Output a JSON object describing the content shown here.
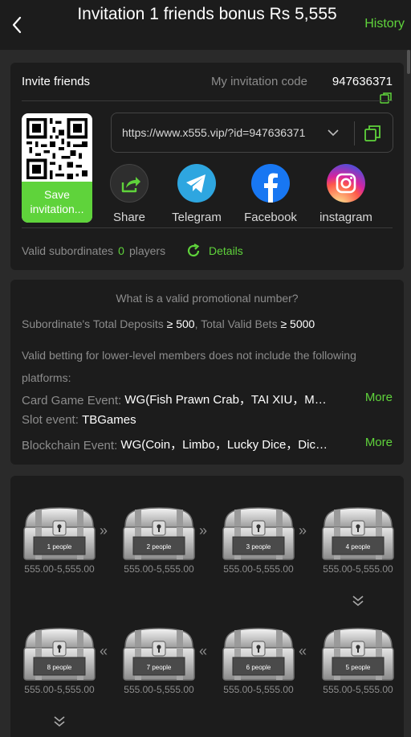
{
  "header": {
    "title": "Invitation 1 friends bonus Rs 5,555",
    "history_label": "History"
  },
  "invite": {
    "label": "Invite friends",
    "code_label": "My invitation code",
    "code_value": "947636371",
    "save_label": "Save invitation...",
    "link": "https://www.x555.vip/?id=947636371",
    "socials": [
      {
        "label": "Share"
      },
      {
        "label": "Telegram"
      },
      {
        "label": "Facebook"
      },
      {
        "label": "instagram"
      }
    ],
    "valid_sub_label": "Valid subordinates",
    "valid_sub_count": "0",
    "valid_sub_unit": "players",
    "details_label": "Details"
  },
  "rules": {
    "question": "What is a valid promotional number?",
    "deposits_label": "Subordinate's Total Deposits",
    "deposits_value": "≥ 500",
    "bets_label": "Total Valid Bets",
    "bets_value": "≥ 5000",
    "note": "Valid betting for lower-level members does not include the following platforms:",
    "events": [
      {
        "label": "Card Game Event:",
        "value": "WG(Fish Prawn Crab，TAI XIU，M…",
        "more": "More"
      },
      {
        "label": "Slot event:",
        "value": "TBGames",
        "more": ""
      },
      {
        "label": "Blockchain Event:",
        "value": "WG(Coin，Limbo，Lucky Dice，Dic…",
        "more": "More"
      }
    ]
  },
  "chests": [
    {
      "people": "1 people",
      "amount": "555.00-5,555.00"
    },
    {
      "people": "2 people",
      "amount": "555.00-5,555.00"
    },
    {
      "people": "3 people",
      "amount": "555.00-5,555.00"
    },
    {
      "people": "4 people",
      "amount": "555.00-5,555.00"
    },
    {
      "people": "5 people",
      "amount": "555.00-5,555.00"
    },
    {
      "people": "6 people",
      "amount": "555.00-5,555.00"
    },
    {
      "people": "7 people",
      "amount": "555.00-5,555.00"
    },
    {
      "people": "8 people",
      "amount": "555.00-5,555.00"
    }
  ],
  "colors": {
    "accent": "#5fd33b",
    "background": "#2a2a2a",
    "card": "#1c1c1c"
  },
  "icons": {
    "back": "chevron-left-icon",
    "copy": "copy-icon",
    "share": "share-icon",
    "telegram": "telegram-icon",
    "facebook": "facebook-icon",
    "instagram": "instagram-icon",
    "refresh": "refresh-icon",
    "forward": "double-chevron-right-icon",
    "backward": "double-chevron-left-icon",
    "down": "double-chevron-down-icon"
  }
}
